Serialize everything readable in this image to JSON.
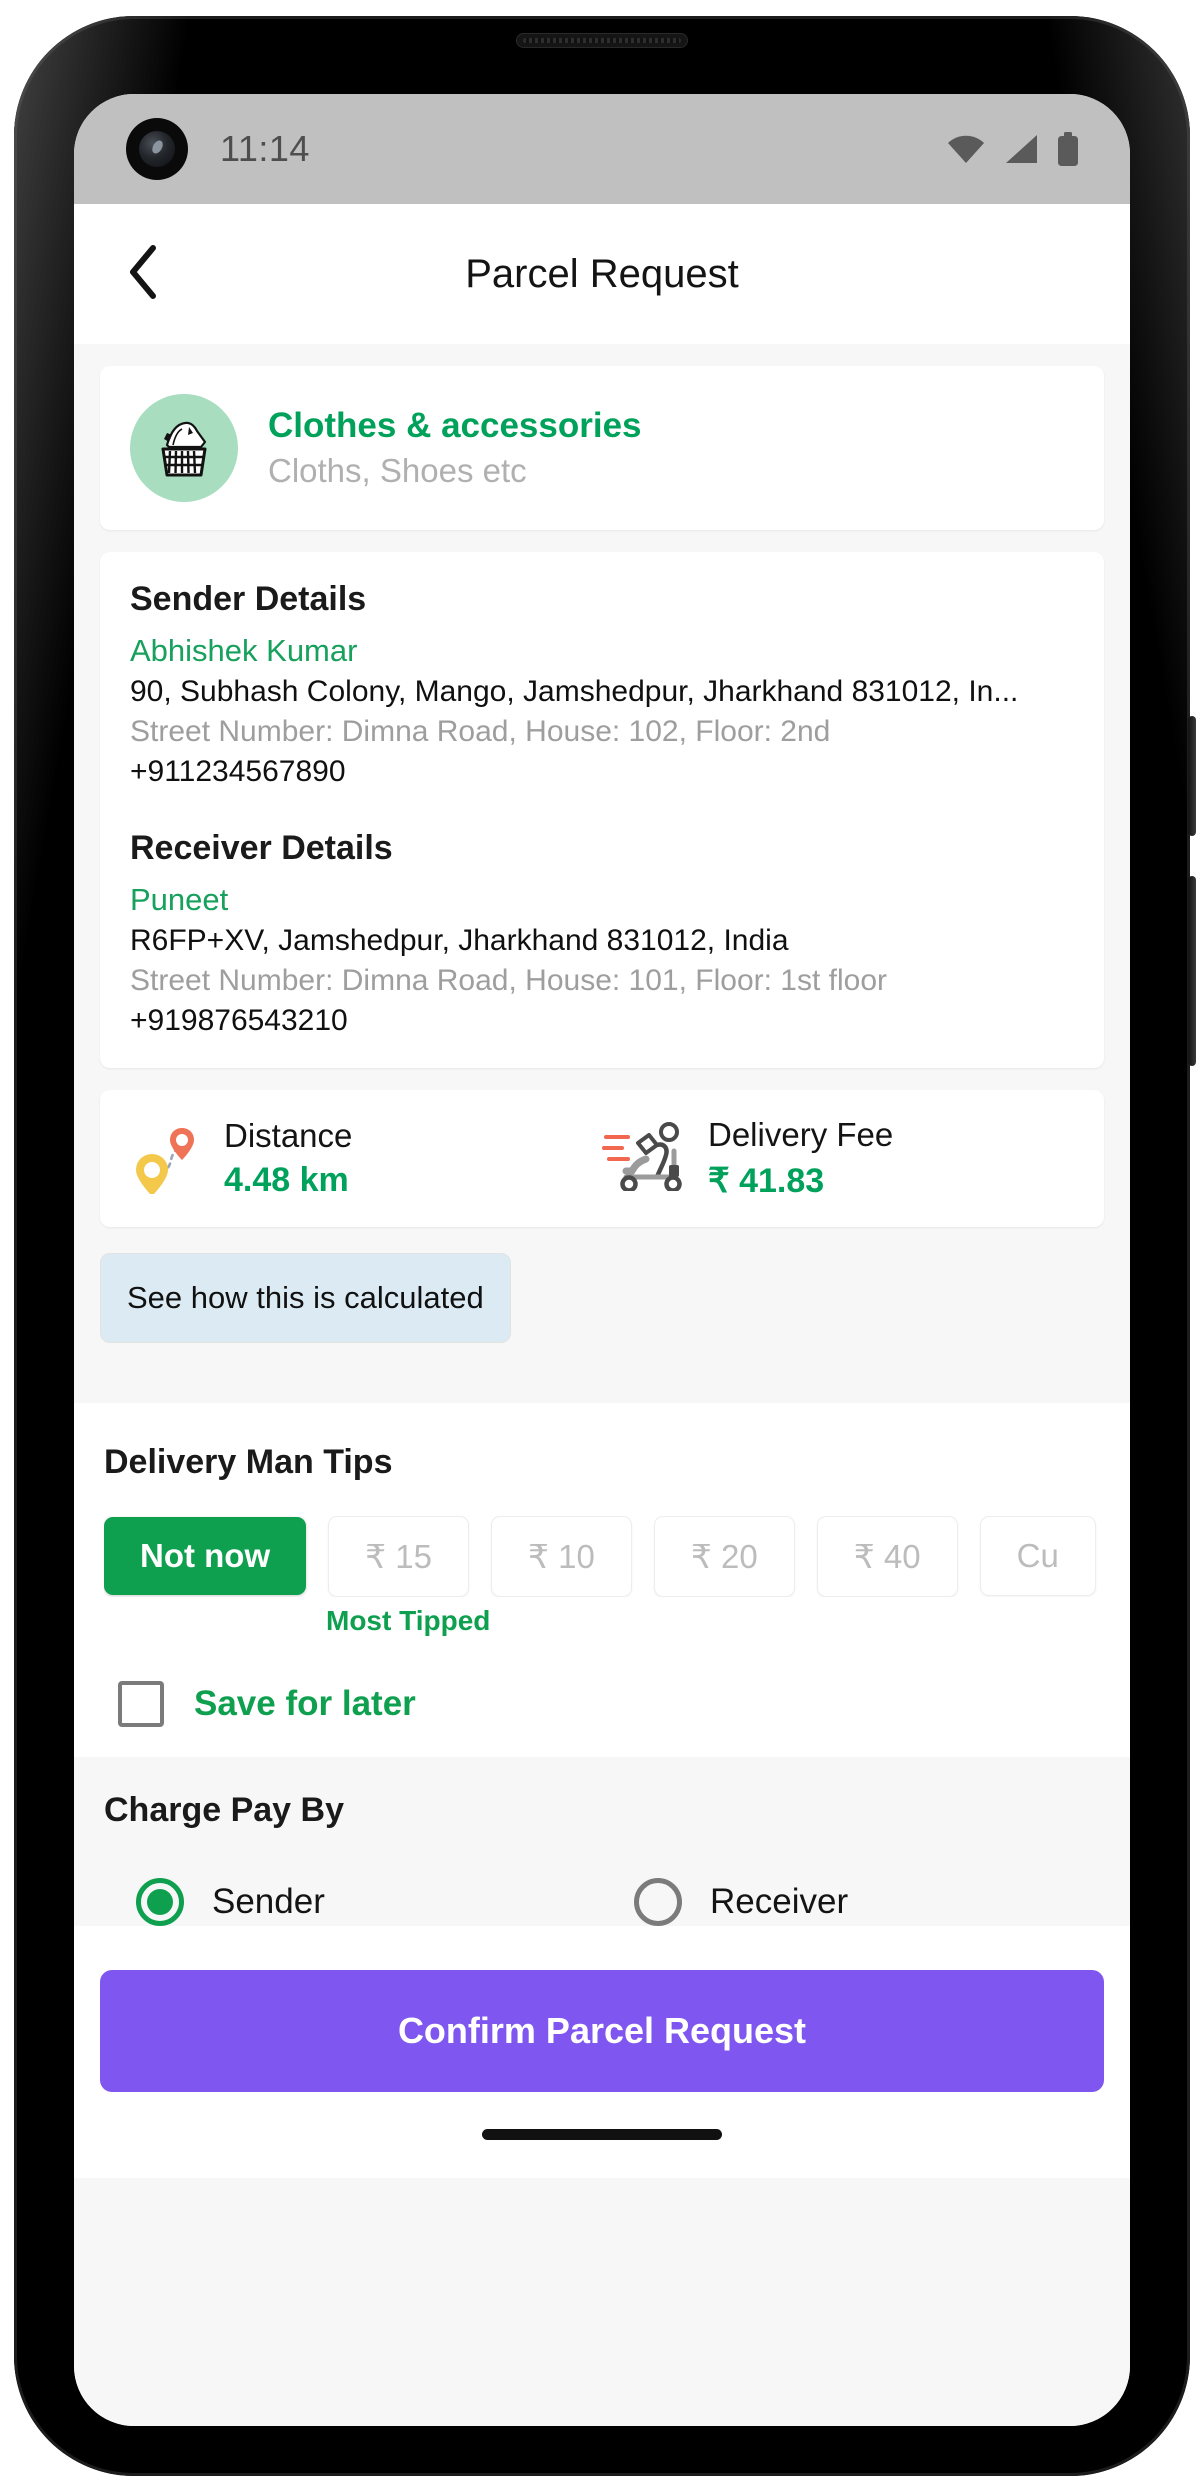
{
  "status_bar": {
    "time": "11:14",
    "icons": [
      "wifi-icon",
      "cellular-signal-icon",
      "battery-icon"
    ]
  },
  "header": {
    "back_icon": "chevron-left-icon",
    "title": "Parcel Request"
  },
  "category": {
    "icon": "laundry-basket-icon",
    "title": "Clothes & accessories",
    "subtitle": "Cloths, Shoes etc"
  },
  "sender": {
    "heading": "Sender Details",
    "name": "Abhishek Kumar",
    "address": "90, Subhash Colony, Mango, Jamshedpur, Jharkhand 831012, In...",
    "meta": "Street Number: Dimna Road, House: 102, Floor: 2nd",
    "phone": "+911234567890"
  },
  "receiver": {
    "heading": "Receiver Details",
    "name": "Puneet",
    "address": "R6FP+XV, Jamshedpur, Jharkhand 831012, India",
    "meta": "Street Number: Dimna Road, House: 101, Floor: 1st floor",
    "phone": "+919876543210"
  },
  "summary": {
    "distance_icon": "route-pin-icon",
    "distance_label": "Distance",
    "distance_value": "4.48 km",
    "fee_icon": "scooter-courier-icon",
    "fee_label": "Delivery Fee",
    "fee_value": "₹ 41.83",
    "calculate_button": "See how this is calculated"
  },
  "tips": {
    "heading": "Delivery Man Tips",
    "chips": [
      {
        "label": "Not now",
        "selected": true
      },
      {
        "label": "₹ 15",
        "selected": false
      },
      {
        "label": "₹ 10",
        "selected": false
      },
      {
        "label": "₹ 20",
        "selected": false
      },
      {
        "label": "₹ 40",
        "selected": false
      },
      {
        "label": "Cu",
        "selected": false
      }
    ],
    "most_tipped_label": "Most Tipped",
    "save_for_later_label": "Save for later",
    "save_for_later_checked": false
  },
  "charge_pay_by": {
    "heading": "Charge Pay By",
    "options": [
      {
        "label": "Sender",
        "selected": true
      },
      {
        "label": "Receiver",
        "selected": false
      }
    ]
  },
  "footer": {
    "confirm_label": "Confirm Parcel Request"
  },
  "colors": {
    "brand_green": "#0ea04f",
    "accent_purple": "#7f56f0",
    "info_blue": "#dcebf3",
    "muted_gray": "#9e9e9e"
  }
}
